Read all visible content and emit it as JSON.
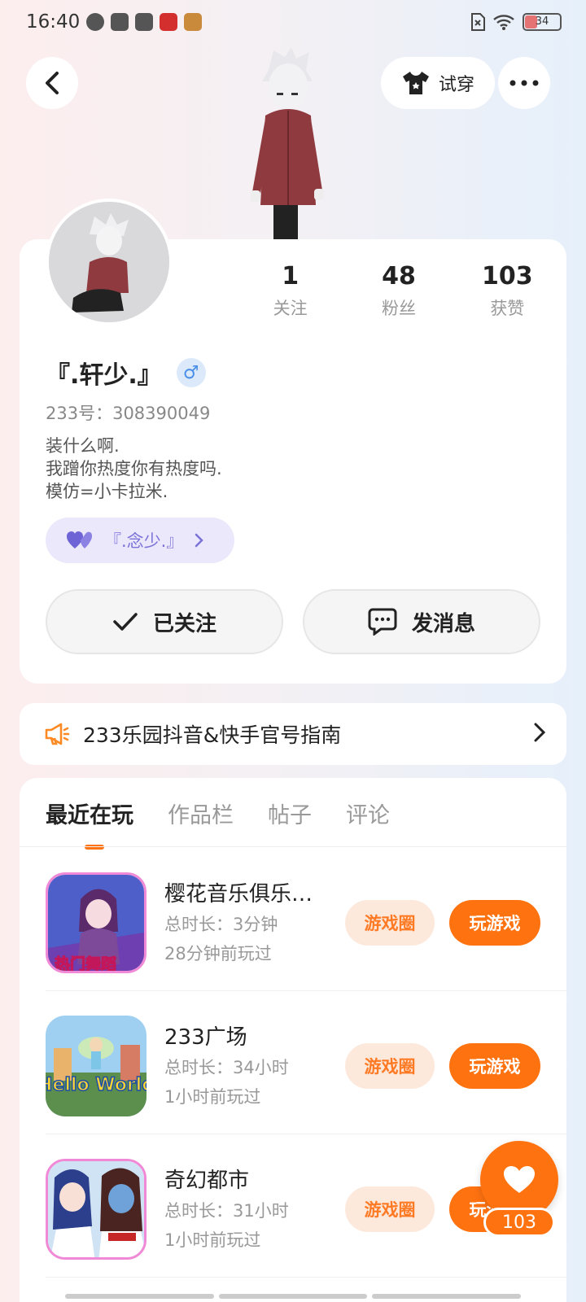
{
  "status_bar": {
    "time": "16:40",
    "battery": "34"
  },
  "header": {
    "try_on_label": "试穿"
  },
  "profile": {
    "stats": [
      {
        "value": "1",
        "label": "关注"
      },
      {
        "value": "48",
        "label": "粉丝"
      },
      {
        "value": "103",
        "label": "获赞"
      }
    ],
    "name": "『.轩少.』",
    "gender_symbol": "♂",
    "uid_text": "233号：308390049",
    "bio": [
      "装什么啊.",
      "我蹭你热度你有热度吗.",
      "模仿=小卡拉米."
    ],
    "couple_name": "『.念少.』",
    "followed_label": "已关注",
    "message_label": "发消息"
  },
  "notice": {
    "text": "233乐园抖音&快手官号指南"
  },
  "tabs": [
    "最近在玩",
    "作品栏",
    "帖子",
    "评论"
  ],
  "games": [
    {
      "title": "樱花音乐俱乐…",
      "duration": "总时长：3分钟",
      "last_played": "28分钟前玩过",
      "icon_text": "热门舞蹈"
    },
    {
      "title": "233广场",
      "duration": "总时长：34小时",
      "last_played": "1小时前玩过",
      "icon_text": "Hello World"
    },
    {
      "title": "奇幻都市",
      "duration": "总时长：31小时",
      "last_played": "1小时前玩过",
      "icon_text": ""
    }
  ],
  "game_actions": {
    "circle_label": "游戏圈",
    "play_label": "玩游戏"
  },
  "like_fab": {
    "count": "103"
  },
  "colors": {
    "accent": "#ff7210",
    "couple": "#7b72d8"
  }
}
